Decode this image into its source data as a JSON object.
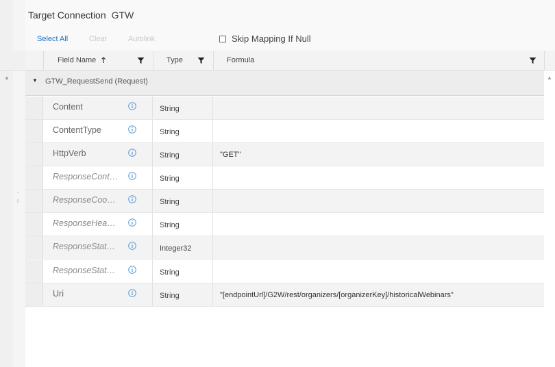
{
  "title": {
    "label": "Target Connection",
    "value": "GTW"
  },
  "toolbar": {
    "select_all": "Select All",
    "clear": "Clear",
    "autolink": "Autolink"
  },
  "skip_mapping": {
    "label": "Skip Mapping If Null",
    "checked": false
  },
  "columns": {
    "field_name": "Field Name",
    "type": "Type",
    "formula": "Formula"
  },
  "group": {
    "label": "GTW_RequestSend (Request)"
  },
  "rows": [
    {
      "name": "Content",
      "type": "String",
      "formula": ""
    },
    {
      "name": "ContentType",
      "type": "String",
      "formula": ""
    },
    {
      "name": "HttpVerb",
      "type": "String",
      "formula": "\"GET\""
    },
    {
      "name": "ResponseCont…",
      "type": "String",
      "formula": ""
    },
    {
      "name": "ResponseCoo…",
      "type": "String",
      "formula": ""
    },
    {
      "name": "ResponseHea…",
      "type": "String",
      "formula": ""
    },
    {
      "name": "ResponseStat…",
      "type": "Integer32",
      "formula": ""
    },
    {
      "name": "ResponseStat…",
      "type": "String",
      "formula": ""
    },
    {
      "name": "Uri",
      "type": "String",
      "formula": "\"[endpointUrl]/G2W/rest/organizers/[organizerKey]/historicalWebinars\""
    }
  ],
  "colors": {
    "accent": "#1a6fc8",
    "info_icon": "#5b9bd5"
  }
}
